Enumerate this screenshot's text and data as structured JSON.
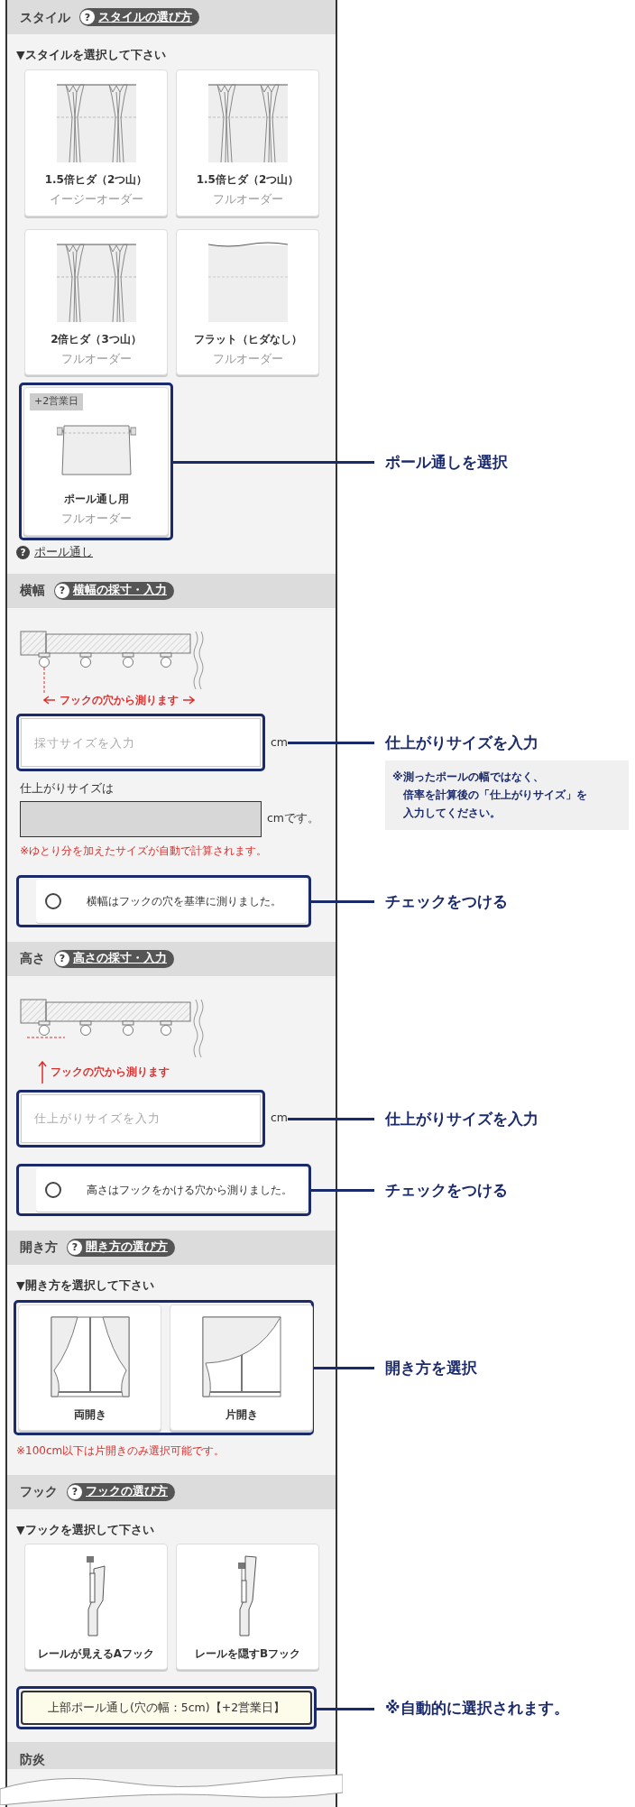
{
  "sections": [
    {
      "kind": "choice",
      "title": "スタイル",
      "help": {
        "mark": "?",
        "link": "スタイルの選び方"
      },
      "prompt": "▼スタイルを選択して下さい",
      "options": [
        {
          "kind": "pleat2",
          "name": "1.5倍ヒダ（2つ山）",
          "sub": "イージーオーダー"
        },
        {
          "kind": "pleat2",
          "name": "1.5倍ヒダ（2つ山）",
          "sub": "フルオーダー"
        },
        {
          "kind": "pleat3",
          "name": "2倍ヒダ（3つ山）",
          "sub": "フルオーダー"
        },
        {
          "kind": "flat",
          "name": "フラット（ヒダなし）",
          "sub": "フルオーダー"
        },
        {
          "kind": "pole",
          "name": "ポール通し用",
          "sub": "フルオーダー",
          "badge": "+2営業日",
          "callout": {
            "text": "ポール通しを選択"
          }
        }
      ],
      "footer_help": {
        "mark": "?",
        "link": "ポール通し"
      }
    },
    {
      "kind": "measure",
      "title": "横幅",
      "help": {
        "mark": "?",
        "link": "横幅の採寸・入力"
      },
      "diagram": {
        "kind": "width",
        "caption": "フックの穴から測ります"
      },
      "input": {
        "placeholder": "採寸サイズを入力",
        "unit": "cm",
        "callout": {
          "text": "仕上がりサイズを入力",
          "note": [
            "※測ったポールの幅ではなく、",
            "倍率を計算後の「仕上がりサイズ」を",
            "入力してください。"
          ]
        }
      },
      "result": {
        "label": "仕上がりサイズは",
        "unit": "cmです。"
      },
      "note": "※ゆとり分を加えたサイズが自動で計算されます。",
      "check": {
        "label": "横幅はフックの穴を基準に測りました。",
        "checked": false,
        "callout": {
          "text": "チェックをつける"
        }
      }
    },
    {
      "kind": "measure",
      "title": "高さ",
      "help": {
        "mark": "?",
        "link": "高さの採寸・入力"
      },
      "diagram": {
        "kind": "height",
        "caption": "フックの穴から測ります"
      },
      "input": {
        "placeholder": "仕上がりサイズを入力",
        "unit": "cm",
        "callout": {
          "text": "仕上がりサイズを入力"
        }
      },
      "check": {
        "label": "高さはフックをかける穴から測りました。",
        "checked": false,
        "callout": {
          "text": "チェックをつける"
        }
      }
    },
    {
      "kind": "choice",
      "title": "開き方",
      "help": {
        "mark": "?",
        "link": "開き方の選び方"
      },
      "prompt": "▼開き方を選択して下さい",
      "options": [
        {
          "kind": "double_open",
          "name": "両開き"
        },
        {
          "kind": "single_open",
          "name": "片開き"
        }
      ],
      "options_callout": {
        "text": "開き方を選択"
      },
      "note": "※100cm以下は片開きのみ選択可能です。"
    },
    {
      "kind": "choice",
      "title": "フック",
      "help": {
        "mark": "?",
        "link": "フックの選び方"
      },
      "prompt": "▼フックを選択して下さい",
      "options": [
        {
          "kind": "hook_a",
          "name": "レールが見えるAフック"
        },
        {
          "kind": "hook_b",
          "name": "レールを隠すBフック"
        }
      ],
      "extra_option": {
        "label": "上部ポール通し(穴の幅：5cm)【+2営業日】",
        "selected": true,
        "callout": {
          "text": "※自動的に選択されます。"
        }
      }
    },
    {
      "kind": "cut",
      "title": "防炎"
    }
  ]
}
